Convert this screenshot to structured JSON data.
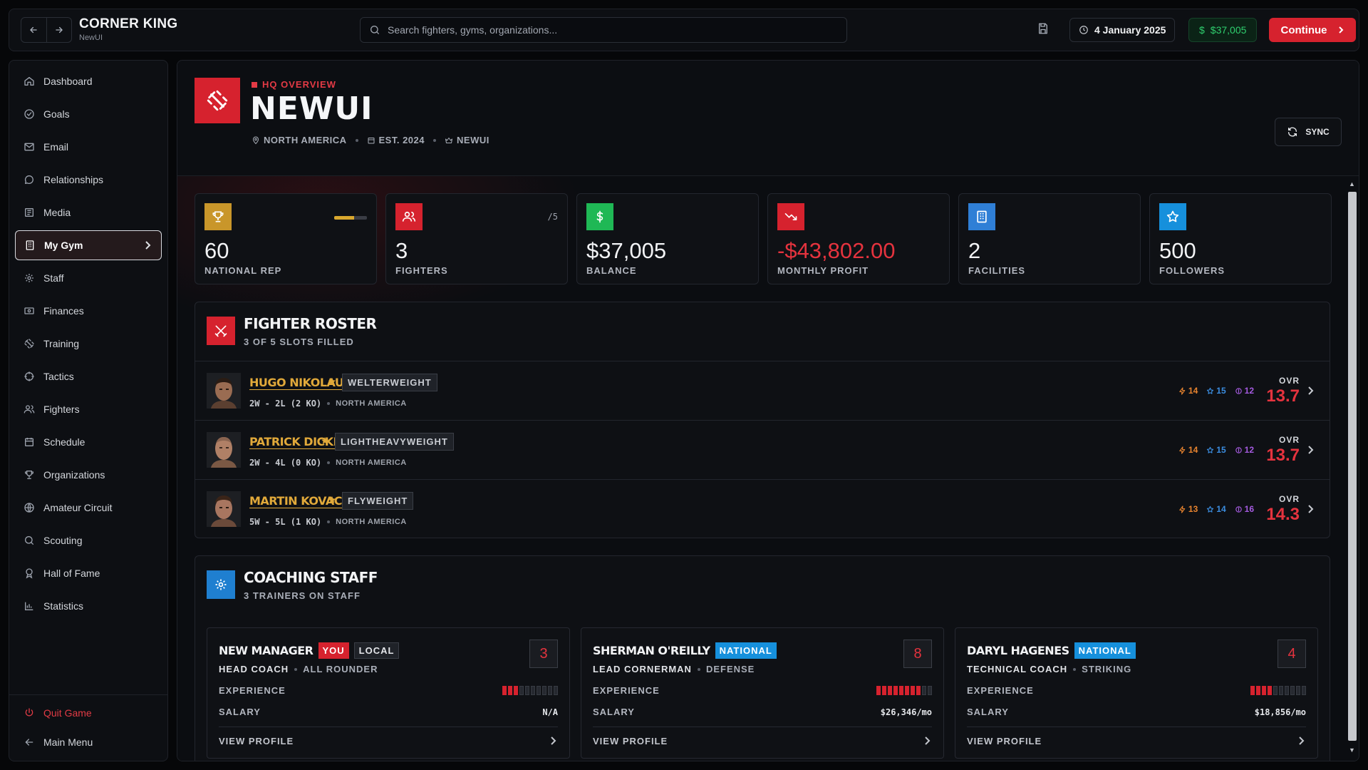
{
  "app": {
    "title": "CORNER KING",
    "subtitle": "NewUI"
  },
  "topbar": {
    "search_placeholder": "Search fighters, gyms, organizations...",
    "date": "4 January 2025",
    "money": "$37,005",
    "continue_label": "Continue"
  },
  "sidebar": {
    "items": [
      {
        "label": "Dashboard",
        "icon": "home-icon"
      },
      {
        "label": "Goals",
        "icon": "target-icon"
      },
      {
        "label": "Email",
        "icon": "mail-icon"
      },
      {
        "label": "Relationships",
        "icon": "chat-icon"
      },
      {
        "label": "Media",
        "icon": "newspaper-icon"
      },
      {
        "label": "My Gym",
        "icon": "building-icon",
        "active": true
      },
      {
        "label": "Staff",
        "icon": "gear-icon"
      },
      {
        "label": "Finances",
        "icon": "banknote-icon"
      },
      {
        "label": "Training",
        "icon": "dumbbell-icon"
      },
      {
        "label": "Tactics",
        "icon": "crosshair-icon"
      },
      {
        "label": "Fighters",
        "icon": "users-icon"
      },
      {
        "label": "Schedule",
        "icon": "calendar-icon"
      },
      {
        "label": "Organizations",
        "icon": "trophy-icon"
      },
      {
        "label": "Amateur Circuit",
        "icon": "globe-icon"
      },
      {
        "label": "Scouting",
        "icon": "search-icon"
      },
      {
        "label": "Hall of Fame",
        "icon": "medal-icon"
      },
      {
        "label": "Statistics",
        "icon": "bar-chart-icon"
      }
    ],
    "quit_label": "Quit Game",
    "main_menu_label": "Main Menu"
  },
  "header": {
    "eyebrow": "HQ OVERVIEW",
    "gym_name": "NEWUI",
    "region": "NORTH AMERICA",
    "established": "EST. 2024",
    "owner": "NEWUI",
    "sync_label": "SYNC"
  },
  "stats": [
    {
      "value": "60",
      "label": "NATIONAL REP",
      "color": "#c9962a",
      "icon": "trophy-icon",
      "progress": 0.6
    },
    {
      "value": "3",
      "label": "FIGHTERS",
      "color": "#d6222e",
      "icon": "users-icon",
      "extra": "/5"
    },
    {
      "value": "$37,005",
      "label": "BALANCE",
      "color": "#1fb855",
      "icon": "dollar-icon"
    },
    {
      "value": "-$43,802.00",
      "label": "MONTHLY PROFIT",
      "color": "#d6222e",
      "icon": "trending-down-icon",
      "negative": true
    },
    {
      "value": "2",
      "label": "FACILITIES",
      "color": "#2f7fd6",
      "icon": "building-icon"
    },
    {
      "value": "500",
      "label": "FOLLOWERS",
      "color": "#1690dc",
      "icon": "star-icon"
    }
  ],
  "roster": {
    "title": "FIGHTER ROSTER",
    "subtitle": "3 OF 5 SLOTS FILLED",
    "fighters": [
      {
        "name": "HUGO NIKOLAUS",
        "weight_class": "WELTERWEIGHT",
        "record": "2W - 2L (2 KO)",
        "region": "NORTH AMERICA",
        "a1": "14",
        "a2": "15",
        "a3": "12",
        "ovr_label": "OVR",
        "ovr": "13.7"
      },
      {
        "name": "PATRICK DICKI",
        "weight_class": "LIGHTHEAVYWEIGHT",
        "record": "2W - 4L (0 KO)",
        "region": "NORTH AMERICA",
        "a1": "14",
        "a2": "15",
        "a3": "12",
        "ovr_label": "OVR",
        "ovr": "13.7"
      },
      {
        "name": "MARTIN KOVACEK",
        "weight_class": "FLYWEIGHT",
        "record": "5W - 5L (1 KO)",
        "region": "NORTH AMERICA",
        "a1": "13",
        "a2": "14",
        "a3": "16",
        "ovr_label": "OVR",
        "ovr": "14.3"
      }
    ]
  },
  "staff": {
    "title": "COACHING STAFF",
    "subtitle": "3 TRAINERS ON STAFF",
    "exp_label": "EXPERIENCE",
    "salary_label": "SALARY",
    "view_label": "VIEW PROFILE",
    "members": [
      {
        "name": "NEW MANAGER",
        "tag1": "YOU",
        "tag2": "LOCAL",
        "role": "HEAD COACH",
        "spec": "ALL ROUNDER",
        "level": "3",
        "experience": 3,
        "salary": "N/A"
      },
      {
        "name": "SHERMAN O'REILLY",
        "tag1": "NATIONAL",
        "role": "LEAD CORNERMAN",
        "spec": "DEFENSE",
        "level": "8",
        "experience": 8,
        "salary": "$26,346/mo"
      },
      {
        "name": "DARYL HAGENES",
        "tag1": "NATIONAL",
        "role": "TECHNICAL COACH",
        "spec": "STRIKING",
        "level": "4",
        "experience": 4,
        "salary": "$18,856/mo"
      }
    ]
  }
}
